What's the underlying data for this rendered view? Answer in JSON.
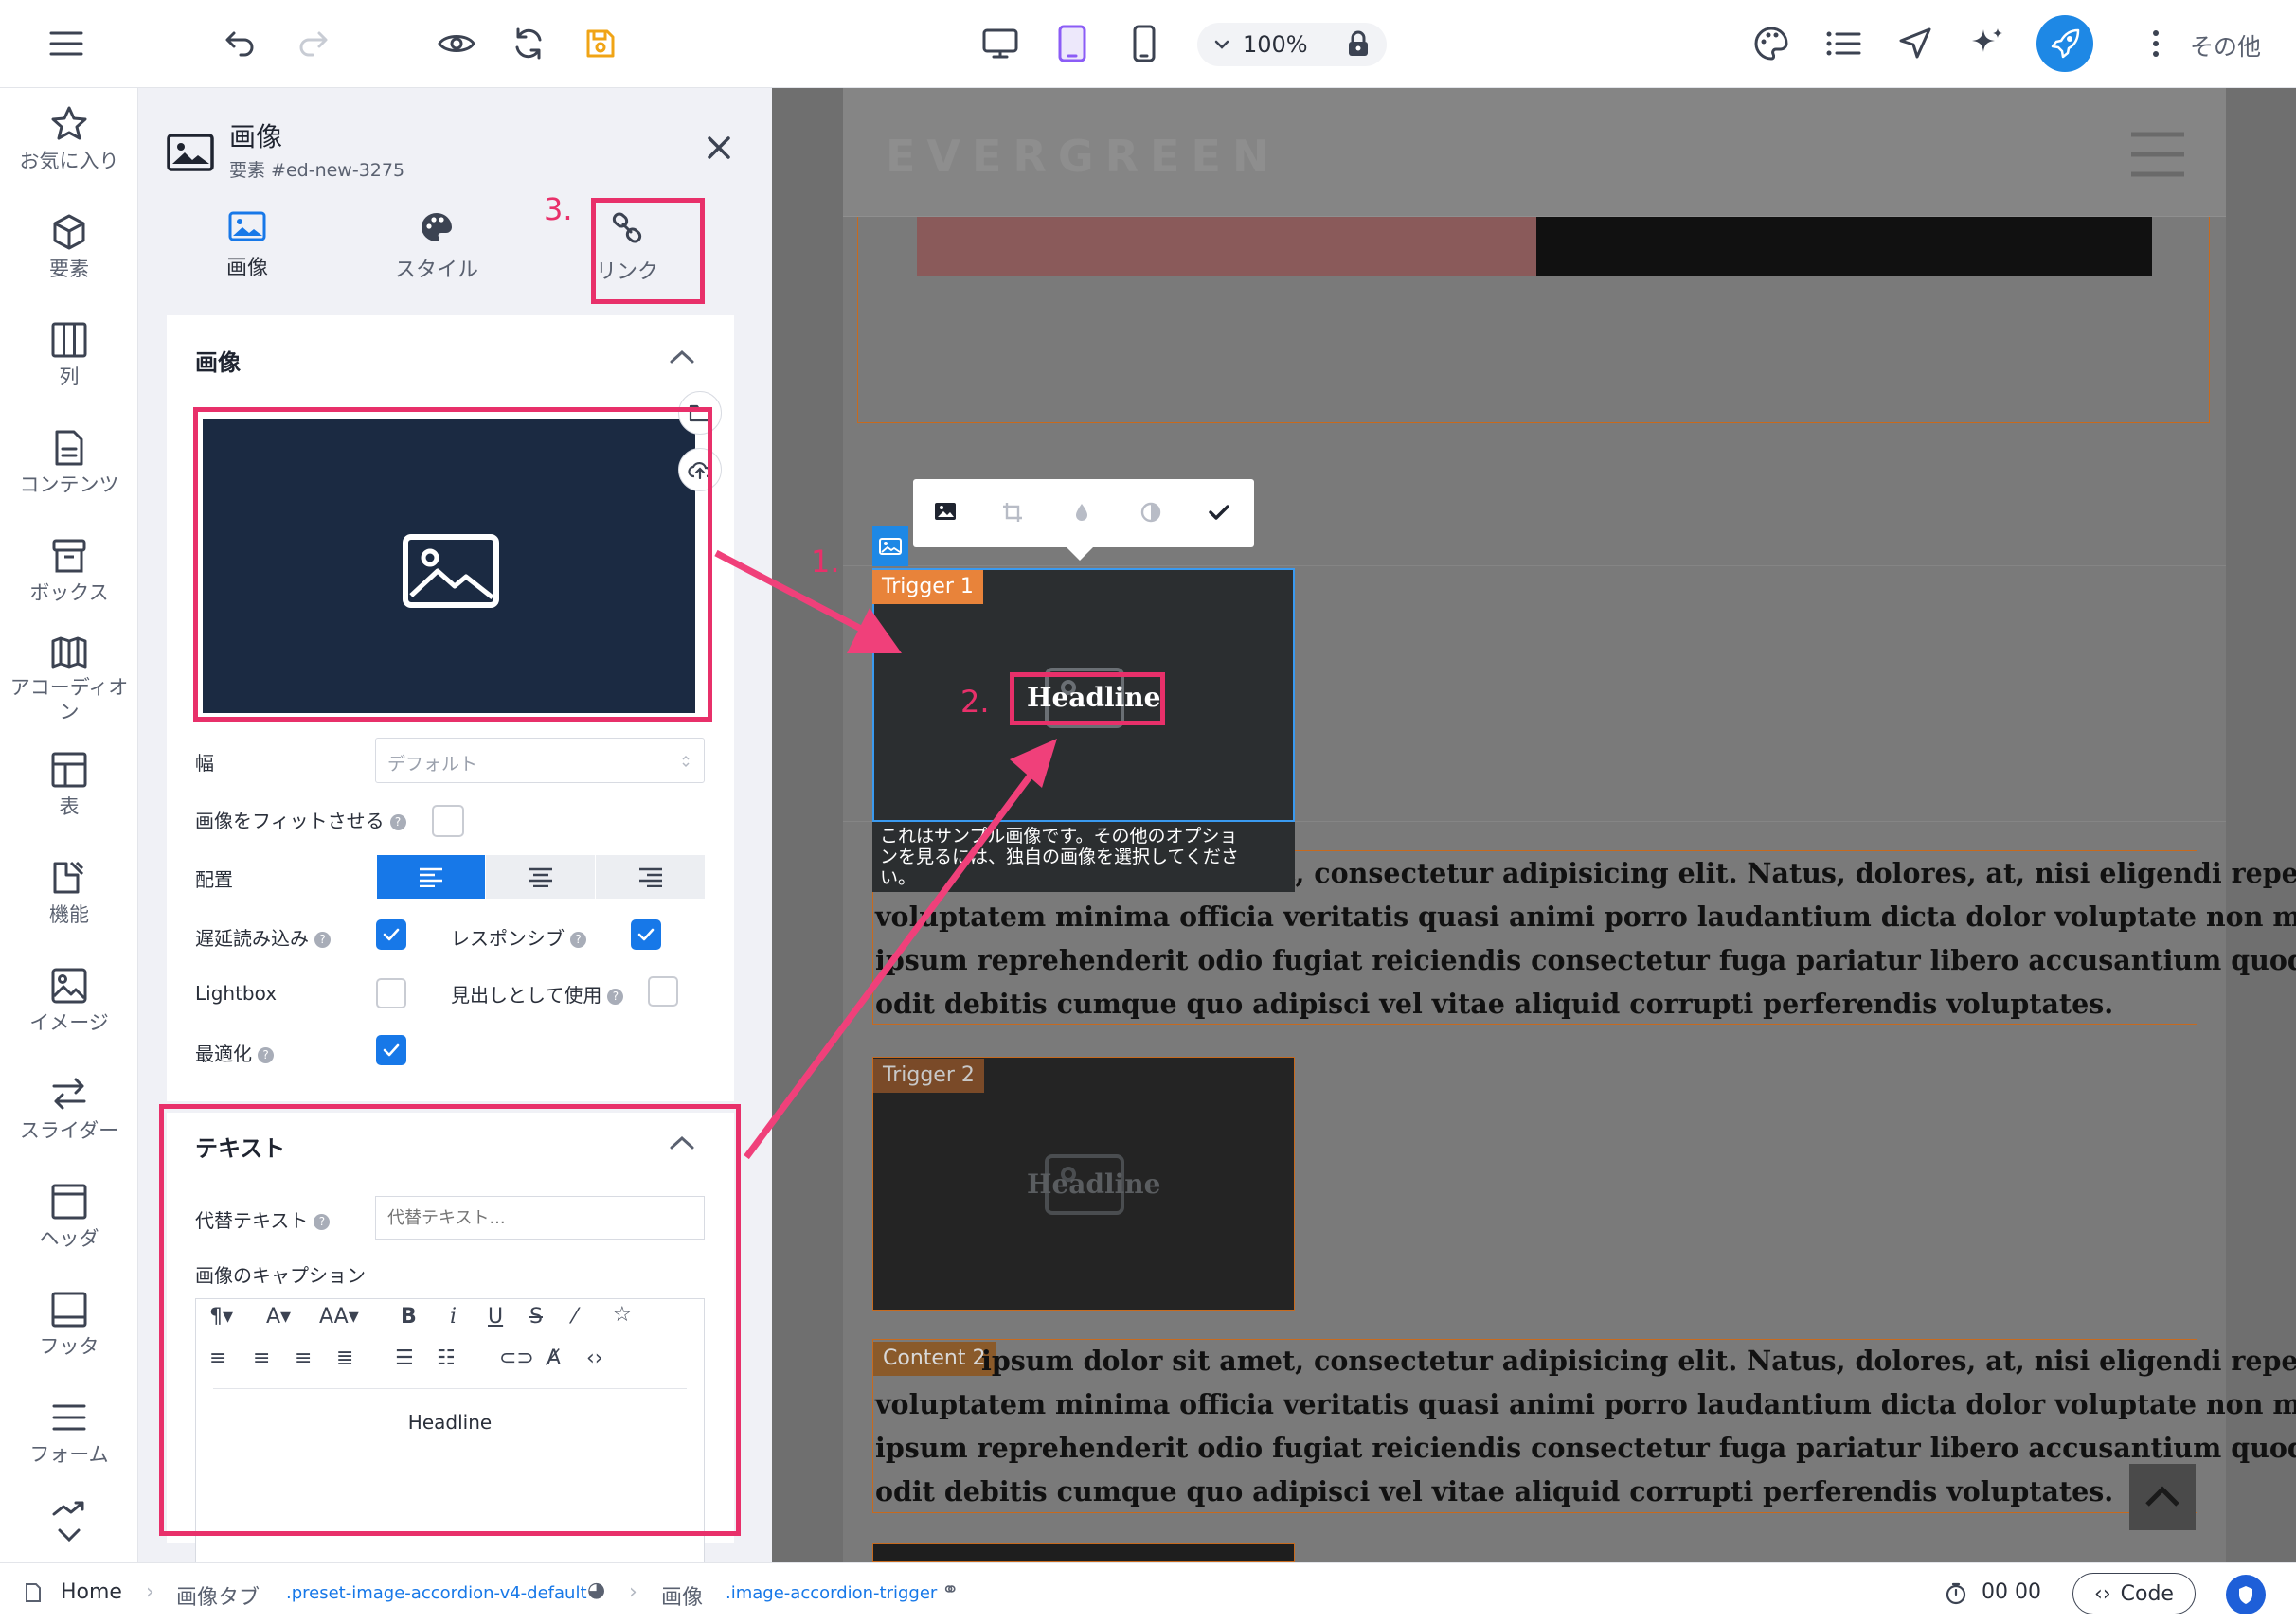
{
  "toolbar": {
    "zoom": "100%",
    "more_label": "その他"
  },
  "sidebar": {
    "items": [
      {
        "label": "お気に入り",
        "icon": "star-icon"
      },
      {
        "label": "要素",
        "icon": "cube-icon"
      },
      {
        "label": "列",
        "icon": "columns-icon"
      },
      {
        "label": "コンテンツ",
        "icon": "document-icon"
      },
      {
        "label": "ボックス",
        "icon": "box-icon"
      },
      {
        "label": "アコーディオン",
        "icon": "accordion-icon"
      },
      {
        "label": "表",
        "icon": "table-icon"
      },
      {
        "label": "機能",
        "icon": "features-icon"
      },
      {
        "label": "イメージ",
        "icon": "image-icon"
      },
      {
        "label": "スライダー",
        "icon": "arrows-icon"
      },
      {
        "label": "ヘッダ",
        "icon": "header-icon"
      },
      {
        "label": "フッタ",
        "icon": "footer-icon"
      },
      {
        "label": "フォーム",
        "icon": "form-icon"
      }
    ]
  },
  "panel": {
    "title": "画像",
    "subtitle": "要素 #ed-new-3275",
    "tabs": {
      "image": "画像",
      "style": "スタイル",
      "link": "リンク"
    },
    "image_section": {
      "title": "画像",
      "width_label": "幅",
      "width_value": "デフォルト",
      "fit_label": "画像をフィットさせる",
      "align_label": "配置",
      "lazy_label": "遅延読み込み",
      "responsive_label": "レスポンシブ",
      "lightbox_label": "Lightbox",
      "heading_label": "見出しとして使用",
      "optimize_label": "最適化",
      "lazy": true,
      "responsive": true,
      "lightbox": false,
      "use_as_heading": false,
      "optimize": true,
      "fit": false
    },
    "text_section": {
      "title": "テキスト",
      "alt_label": "代替テキスト",
      "alt_placeholder": "代替テキスト...",
      "caption_label": "画像のキャプション",
      "caption_value": "Headline"
    }
  },
  "annotations": {
    "one": "1.",
    "two": "2.",
    "three": "3.",
    "color": "#e8306a"
  },
  "canvas": {
    "site_logo": "EVERGREEN",
    "trigger1": "Trigger 1",
    "trigger2": "Trigger 2",
    "content2": "Content 2",
    "headline": "Headline",
    "tooltip_line1": "これはサンプル画像です。その他のオプショ",
    "tooltip_line2": "ンを見るには、独自の画像を選択してくださ",
    "tooltip_line3": "い。",
    "para_lines": [
      "Lorem ipsum dolor sit amet, consectetur adipisicing elit. Natus, dolores, at, nisi eligendi repellat",
      "voluptatem minima officia veritatis quasi animi porro laudantium dicta dolor voluptate non maiores",
      "ipsum reprehenderit odio fugiat reiciendis consectetur fuga pariatur libero accusantium quod minus",
      "odit debitis cumque quo adipisci vel vitae aliquid corrupti perferendis voluptates."
    ],
    "content2_first_line": "ipsum dolor sit amet, consectetur adipisicing elit. Natus, dolores, at, nisi eligendi repellat"
  },
  "statusbar": {
    "home": "Home",
    "crumb1": "画像タブ",
    "crumb1_class": ".preset-image-accordion-v4-default",
    "crumb2": "画像",
    "crumb2_class": ".image-accordion-trigger",
    "time": "00 00",
    "code": "Code"
  }
}
